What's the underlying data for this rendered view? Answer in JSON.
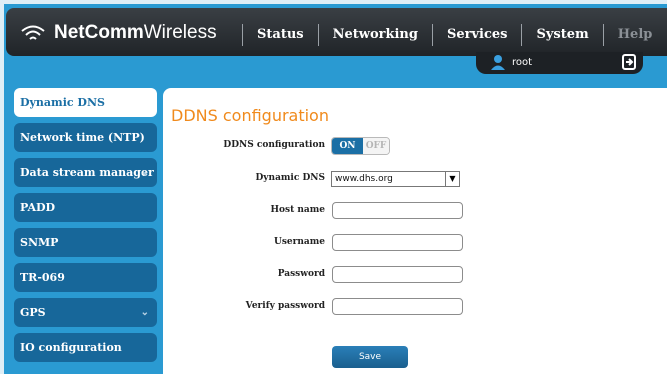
{
  "brand": {
    "bold": "NetComm",
    "light": "Wireless"
  },
  "nav": {
    "items": [
      "Status",
      "Networking",
      "Services",
      "System",
      "Help"
    ]
  },
  "user": {
    "name": "root"
  },
  "sidebar": {
    "items": [
      {
        "label": "Dynamic DNS",
        "active": true
      },
      {
        "label": "Network time (NTP)"
      },
      {
        "label": "Data stream manager",
        "chevron": "⌄"
      },
      {
        "label": "PADD"
      },
      {
        "label": "SNMP"
      },
      {
        "label": "TR-069"
      },
      {
        "label": "GPS",
        "chevron": "⌄"
      },
      {
        "label": "IO configuration"
      }
    ]
  },
  "form": {
    "title": "DDNS configuration",
    "ddns_label": "DDNS configuration",
    "toggle_on": "ON",
    "toggle_off": "OFF",
    "dynamic_dns_label": "Dynamic DNS",
    "dynamic_dns_value": "www.dhs.org",
    "host_label": "Host name",
    "username_label": "Username",
    "password_label": "Password",
    "verify_label": "Verify password",
    "save_label": "Save"
  },
  "colors": {
    "accent": "#1b6fa5",
    "title": "#f08a1c",
    "background": "#2a9ad2"
  }
}
